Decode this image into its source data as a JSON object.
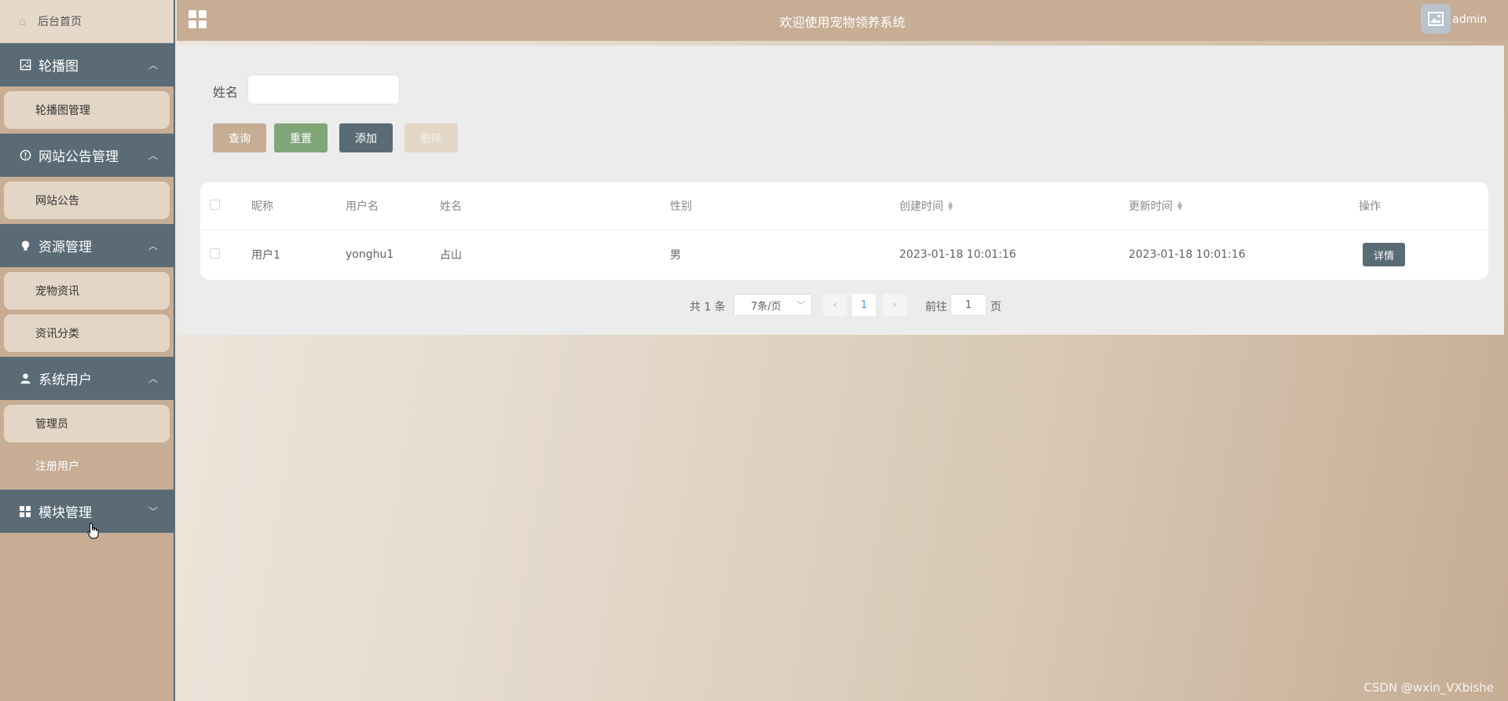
{
  "sidebar": {
    "home": "后台首页",
    "groups": [
      {
        "title": "轮播图",
        "items": [
          "轮播图管理"
        ]
      },
      {
        "title": "网站公告管理",
        "items": [
          "网站公告"
        ]
      },
      {
        "title": "资源管理",
        "items": [
          "宠物资讯",
          "资讯分类"
        ]
      },
      {
        "title": "系统用户",
        "items": [
          "管理员",
          "注册用户"
        ]
      },
      {
        "title": "模块管理",
        "items": []
      }
    ]
  },
  "header": {
    "title": "欢迎使用宠物领养系统",
    "username": "admin"
  },
  "search": {
    "label": "姓名",
    "value": "",
    "buttons": {
      "query": "查询",
      "reset": "重置",
      "add": "添加",
      "delete": "删除"
    }
  },
  "table": {
    "columns": [
      "昵称",
      "用户名",
      "姓名",
      "性别",
      "创建时间",
      "更新时间",
      "操作"
    ],
    "rows": [
      {
        "nickname": "用户1",
        "username": "yonghu1",
        "name": "占山",
        "gender": "男",
        "created": "2023-01-18 10:01:16",
        "updated": "2023-01-18 10:01:16",
        "action": "详情"
      }
    ]
  },
  "pagination": {
    "total_text": "共 1 条",
    "page_size": "7条/页",
    "current_page": "1",
    "goto_label": "前往",
    "goto_value": "1",
    "page_suffix": "页"
  },
  "watermark": "CSDN @wxin_VXbishe",
  "colors": {
    "primary": "#5a6b76",
    "tan": "#c6ad94",
    "green": "#80a579",
    "item_bg": "#e3d6c6"
  }
}
